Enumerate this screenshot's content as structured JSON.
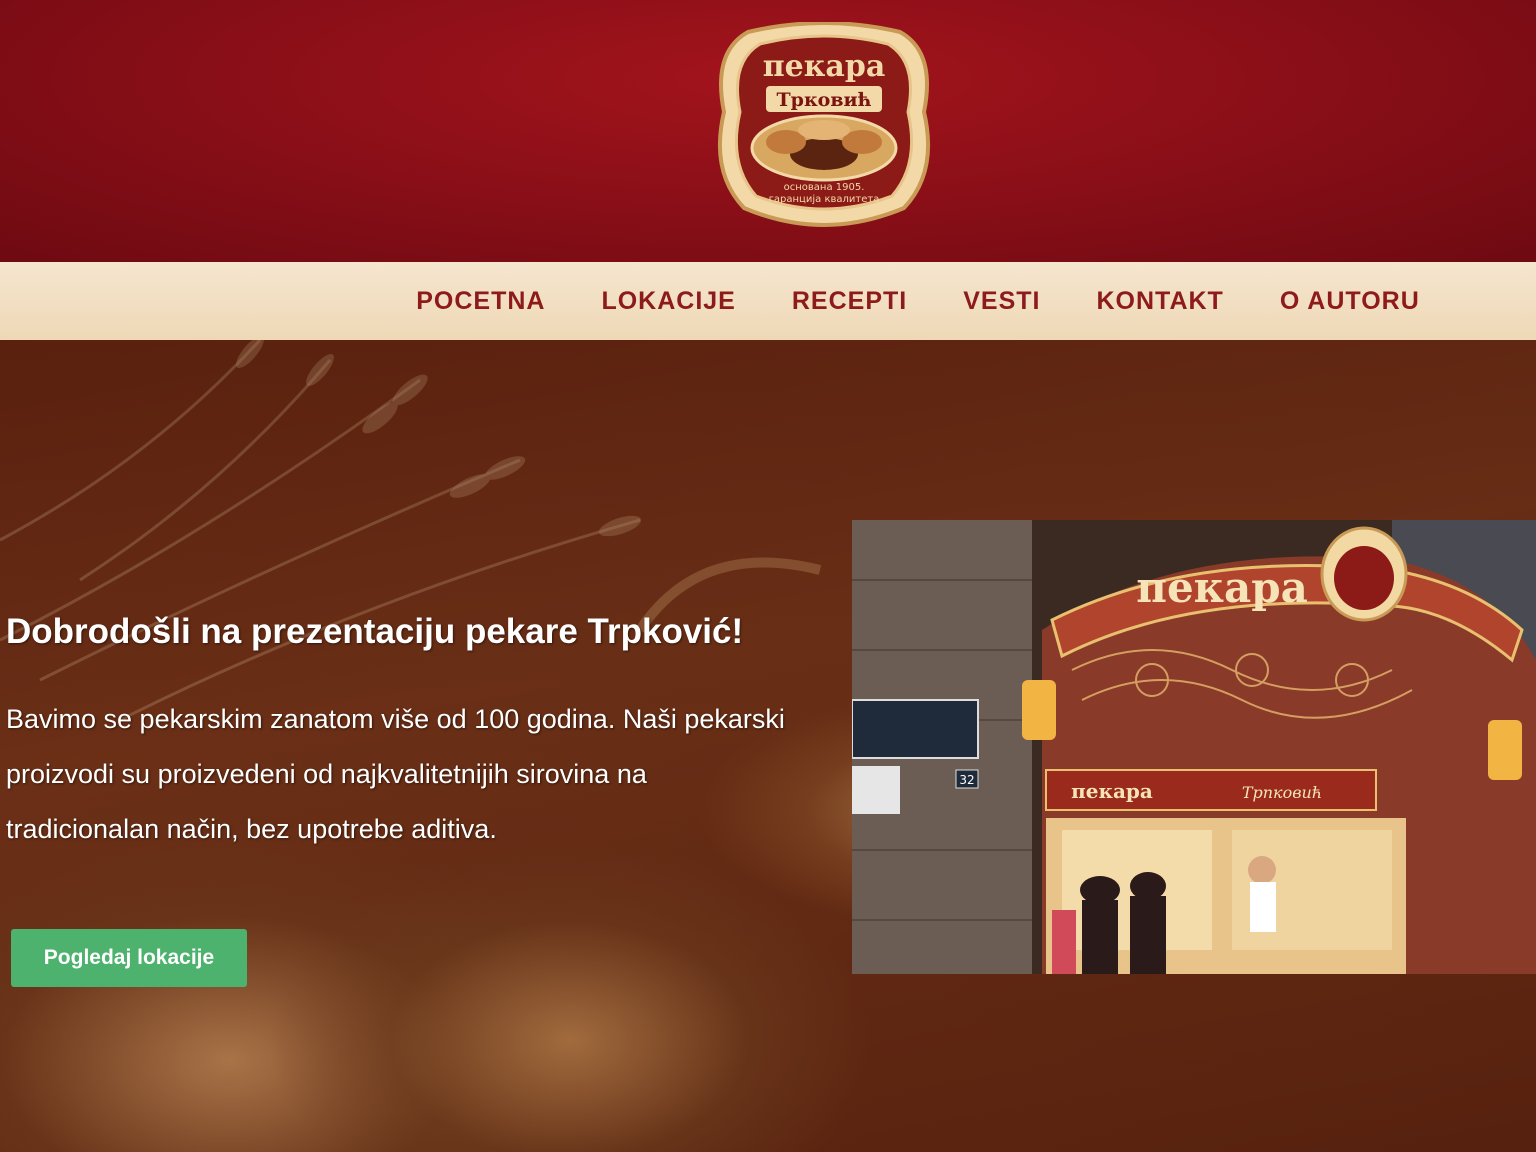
{
  "logo": {
    "top_text": "пекара",
    "name_text": "Трковић",
    "founded_text": "основана 1905.",
    "guarantee_text": "гаранција квалитета"
  },
  "nav": {
    "items": [
      {
        "label": "POCETNA"
      },
      {
        "label": "LOKACIJE"
      },
      {
        "label": "RECEPTI"
      },
      {
        "label": "VESTI"
      },
      {
        "label": "KONTAKT"
      },
      {
        "label": "O AUTORU"
      }
    ]
  },
  "hero": {
    "title": "Dobrodošli na prezentaciju pekare Trpković!",
    "text": "Bavimo se pekarskim zanatom više od 100 godina. Naši pekarski proizvodi su proizvedeni od najkvalitetnijih sirovina na tradicionalan način, bez upotrebe aditiva.",
    "button_label": "Pogledaj lokacije"
  },
  "photo": {
    "sign_text": "пекара",
    "shop_sign": "пекара",
    "shop_name": "Трпковић",
    "street_number": "32"
  },
  "colors": {
    "header_red": "#8c0f18",
    "nav_cream": "#f3e1c5",
    "nav_text": "#8e1b1b",
    "button_green": "#4cb26d"
  }
}
